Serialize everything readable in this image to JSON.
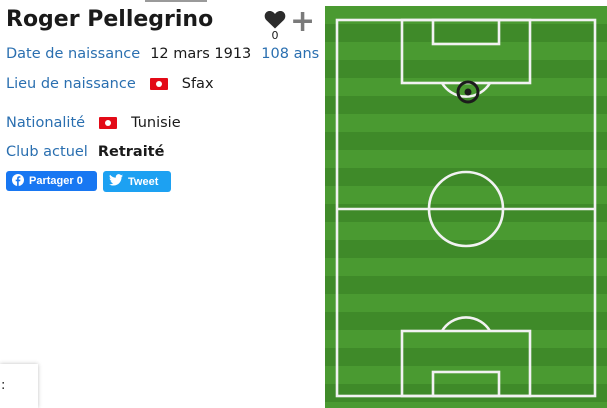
{
  "player": {
    "name": "Roger Pellegrino",
    "favorite_count": "0"
  },
  "details": {
    "birth_date_label": "Date de naissance",
    "birth_date": "12 mars 1913",
    "age": "108 ans",
    "birth_place_label": "Lieu de naissance",
    "birth_place": "Sfax",
    "nationality_label": "Nationalité",
    "nationality": "Tunisie",
    "club_label": "Club actuel",
    "club": "Retraité"
  },
  "share": {
    "facebook_label": "Partager 0",
    "twitter_label": "Tweet"
  },
  "corner_text": ":",
  "colors": {
    "link": "#2a6fb0",
    "facebook": "#1877f2",
    "twitter": "#1da1f2",
    "pitch_light": "#4a9a31",
    "pitch_dark": "#3f8a29",
    "tunisia_flag": "#e30a17"
  },
  "icons": [
    "heart-icon",
    "plus-icon",
    "tunisia-flag-icon",
    "facebook-icon",
    "twitter-icon"
  ]
}
